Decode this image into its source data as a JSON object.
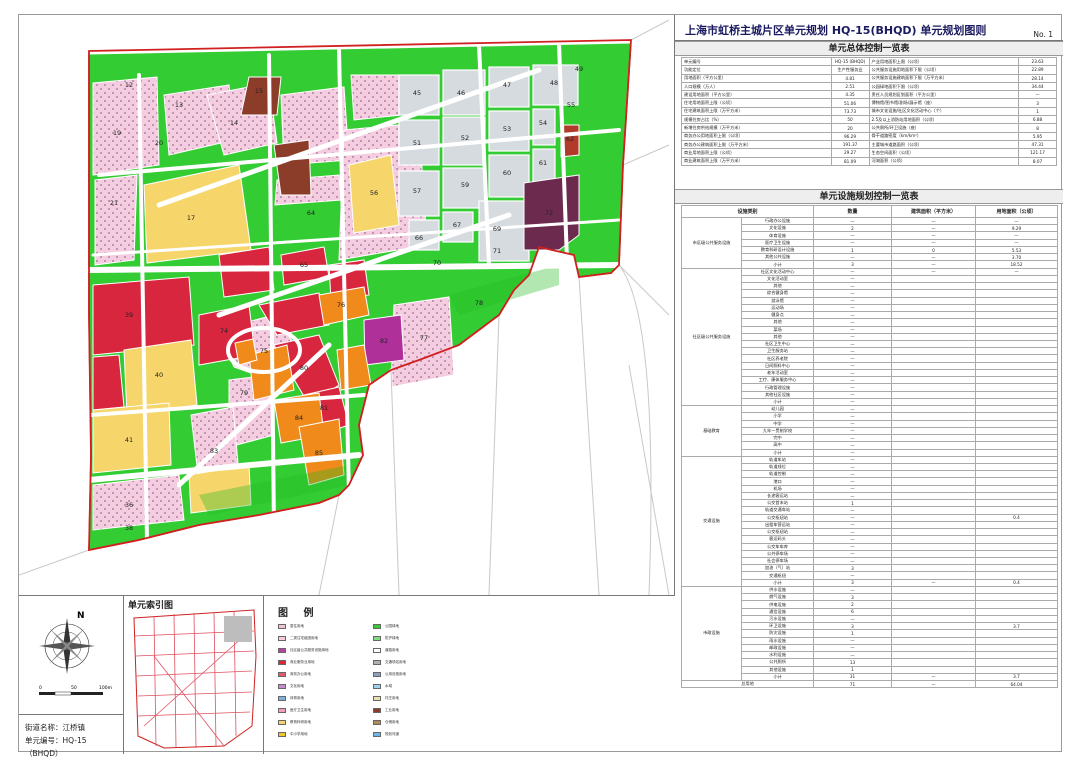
{
  "title": "上海市虹桥主城片区单元规划  HQ-15(BHQD) 单元规划图则",
  "sheet_no": "No. 1",
  "sections": {
    "overall_control": "单元总体控制一览表",
    "facilities_control": "单元设施规划控制一览表",
    "index_map": "单元索引图",
    "legend": "图 例"
  },
  "street": "街道名称：江桥镇",
  "unit_code": "单元编号：HQ-15（BHQD）",
  "scale_bar": [
    "0",
    "50",
    "100m"
  ],
  "north_label": "N",
  "colors": {
    "road": "#ffffff",
    "green": "#33cc33",
    "residential": "#f3c1d6",
    "residential_pattern": "#a98aa8",
    "commercial": "#d9263f",
    "mixed": "#f08a1a",
    "education": "#f6d56a",
    "warehouse_existing": "#d6dbe0",
    "industrial": "#8b3d2a",
    "purple": "#7d2a7d",
    "magenta": "#c23ca8",
    "water": "#ffffff",
    "boundary": "#d02020"
  },
  "map": {
    "parcels": [
      "12",
      "13",
      "14",
      "15",
      "17",
      "19",
      "20",
      "21",
      "36",
      "38",
      "39",
      "40",
      "41",
      "45",
      "46",
      "47",
      "48",
      "49",
      "51",
      "52",
      "53",
      "54",
      "55",
      "56",
      "57",
      "59",
      "60",
      "61",
      "62",
      "64",
      "65",
      "66",
      "67",
      "69",
      "70",
      "71",
      "72",
      "74",
      "75",
      "76",
      "77",
      "78",
      "79",
      "80",
      "81",
      "82",
      "83",
      "84",
      "85"
    ],
    "road_label": "纪翟路"
  },
  "overall_table": {
    "rows": [
      [
        "单元编号",
        "HQ-15 (BHQD)",
        "产业用地面积上限（公顷）",
        "23.63"
      ],
      [
        "功能定位",
        "生产性服务业",
        "公共服务设施用地面积下限（公顷）",
        "22.89"
      ],
      [
        "用地面积（平方公里）",
        "4.81",
        "公共服务设施建筑面积下限（万平方米）",
        "28.14"
      ],
      [
        "人口规模（万人）",
        "2.51",
        "公园绿地面积下限（公顷）",
        "34.44"
      ],
      [
        "建设用地面积（平方公里）",
        "4.35",
        "责任人员规划区划面积（平方公里）",
        "—"
      ],
      [
        "住宅用地面积上限（公顷）",
        "51.06",
        "博物馆/图书馆/剧场/展示馆（座）",
        "3"
      ],
      [
        "住宅建筑面积上限（万平方米）",
        "73.73",
        "城市文化设施/社区文化活动中心（个）",
        "1"
      ],
      [
        "规模住房占比（%）",
        "50",
        "2.5及以上消防站用地面积（公顷）",
        "6.88"
      ],
      [
        "新增住房供给规模（万平方米）",
        "20",
        "公共厕所/环卫设施（座）",
        "8"
      ],
      [
        "商务办公用地面积上限（公顷）",
        "96.29",
        "骨干道路密度（km/km²）",
        "5.95"
      ],
      [
        "商务办公建筑面积上限（万平方米）",
        "191.37",
        "主要城市道路面积（公顷）",
        "47.31"
      ],
      [
        "商业用地面积上限（公顷）",
        "29.27",
        "生态空间面积（公顷）",
        "121.17"
      ],
      [
        "商业建筑面积上限（万平方米）",
        "81.09",
        "河湖面积（公顷）",
        "8.07"
      ]
    ]
  },
  "facility_table": {
    "headers": [
      "设施类别",
      "",
      "数量",
      "建筑面积（平方米）",
      "用地面积（公顷）"
    ],
    "groups": [
      {
        "category": "市区级公共服务设施",
        "sub": "",
        "items": [
          [
            "行政办公设施",
            "—",
            "—",
            "—"
          ],
          [
            "文化设施",
            "2",
            "—",
            "9.29"
          ],
          [
            "体育设施",
            "—",
            "—",
            "—"
          ],
          [
            "医疗卫生设施",
            "—",
            "—",
            "—"
          ],
          [
            "教育科研设计设施",
            "1",
            "0",
            "5.53"
          ],
          [
            "其他公共设施",
            "—",
            "—",
            "3.70"
          ],
          [
            "小计",
            "3",
            "—",
            "18.52"
          ]
        ]
      },
      {
        "category": "社区级公共服务设施",
        "sub": "",
        "items": [
          [
            "社区文化活动中心",
            "—",
            "—",
            "—"
          ],
          [
            "文化活动室",
            "—",
            "",
            ""
          ],
          [
            "其他",
            "—",
            "",
            ""
          ],
          [
            "综合健身馆",
            "—",
            "",
            ""
          ],
          [
            "游泳馆",
            "—",
            "",
            ""
          ],
          [
            "运动场",
            "—",
            "",
            ""
          ],
          [
            "健身点",
            "—",
            "",
            ""
          ],
          [
            "其他",
            "—",
            "",
            ""
          ],
          [
            "菜场",
            "—",
            "",
            ""
          ],
          [
            "其他",
            "—",
            "",
            ""
          ],
          [
            "社区卫生中心",
            "—",
            "",
            ""
          ],
          [
            "卫生服务站",
            "—",
            "",
            ""
          ],
          [
            "社区养老院",
            "—",
            "",
            ""
          ],
          [
            "日间照料中心",
            "—",
            "",
            ""
          ],
          [
            "老年活动室",
            "—",
            "",
            ""
          ],
          [
            "工疗、康体服务中心",
            "—",
            "",
            ""
          ],
          [
            "行政管理设施",
            "—",
            "",
            ""
          ],
          [
            "其他社区设施",
            "—",
            "",
            ""
          ],
          [
            "小计",
            "—",
            "",
            ""
          ]
        ]
      },
      {
        "category": "基础教育",
        "sub": "",
        "items": [
          [
            "幼儿园",
            "—",
            "",
            ""
          ],
          [
            "小学",
            "—",
            "",
            ""
          ],
          [
            "中学",
            "—",
            "",
            ""
          ],
          [
            "九年一贯制学校",
            "—",
            "",
            ""
          ],
          [
            "完中",
            "—",
            "",
            ""
          ],
          [
            "高中",
            "—",
            "",
            ""
          ],
          [
            "小计",
            "—",
            "",
            ""
          ]
        ]
      },
      {
        "category": "交通设施",
        "sub": "",
        "items": [
          [
            "轨道车站",
            "—",
            "",
            ""
          ],
          [
            "轨道线位",
            "—",
            "",
            ""
          ],
          [
            "轨道控制",
            "—",
            "",
            ""
          ],
          [
            "港口",
            "—",
            "",
            ""
          ],
          [
            "机场",
            "—",
            "",
            ""
          ],
          [
            "长途客运站",
            "—",
            "",
            ""
          ],
          [
            "公交首末站",
            "1",
            "",
            ""
          ],
          [
            "轨道交通车站",
            "—",
            "",
            ""
          ],
          [
            "公交枢纽站",
            "—",
            "",
            "0.4"
          ],
          [
            "出租车营运站",
            "—",
            "",
            ""
          ],
          [
            "公交枢纽站",
            "—",
            "",
            ""
          ],
          [
            "客运码头",
            "—",
            "",
            ""
          ],
          [
            "公交车车库",
            "—",
            "",
            ""
          ],
          [
            "公共停车场",
            "—",
            "",
            ""
          ],
          [
            "社会停车场",
            "—",
            "",
            ""
          ],
          [
            "加油（气）站",
            "3",
            "",
            ""
          ],
          [
            "交通枢纽",
            "—",
            "",
            ""
          ],
          [
            "小计",
            "3",
            "—",
            "0.4"
          ]
        ]
      },
      {
        "category": "市政设施",
        "sub": "",
        "items": [
          [
            "供水设施",
            "—",
            "",
            ""
          ],
          [
            "燃气设施",
            "3",
            "",
            ""
          ],
          [
            "供电设施",
            "2",
            "",
            ""
          ],
          [
            "通信设施",
            "6",
            "",
            ""
          ],
          [
            "污水设施",
            "—",
            "",
            ""
          ],
          [
            "环卫设施",
            "3",
            "",
            "3.7"
          ],
          [
            "防灾设施",
            "1",
            "",
            ""
          ],
          [
            "雨水设施",
            "—",
            "",
            ""
          ],
          [
            "邮政设施",
            "—",
            "",
            ""
          ],
          [
            "水利设施",
            "—",
            "",
            ""
          ],
          [
            "公共厕所",
            "13",
            "",
            ""
          ],
          [
            "其他设施",
            "1",
            "",
            ""
          ],
          [
            "小计",
            "31",
            "—",
            "3.7"
          ]
        ]
      }
    ],
    "total": [
      "总用地",
      "71",
      "—",
      "64.04"
    ]
  },
  "legend_items": [
    "居住用地",
    "二类住宅组团用地",
    "社区级公共服务设施用地",
    "商业服务业用地",
    "商务办公用地",
    "文化用地",
    "体育用地",
    "医疗卫生用地",
    "教育科研用地",
    "中小学用地",
    "公园绿地",
    "防护绿地",
    "道路用地",
    "交通场站用地",
    "公用设施用地",
    "水域",
    "村庄用地",
    "工业用地",
    "仓储用地",
    "规划河道"
  ]
}
